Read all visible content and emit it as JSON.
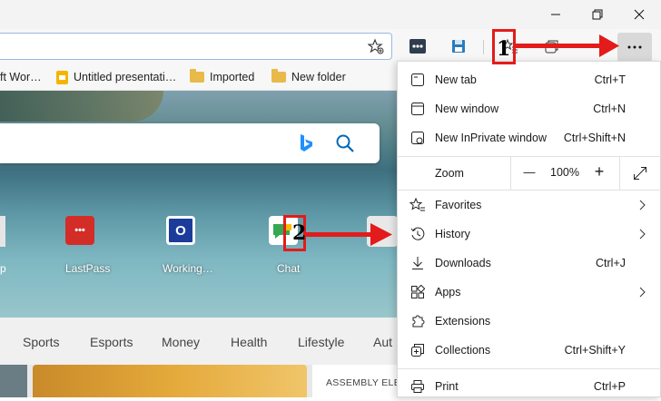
{
  "favorites_bar": {
    "items": [
      {
        "label": "ft Wor…"
      },
      {
        "label": "Untitled presentati…"
      },
      {
        "label": "Imported"
      },
      {
        "label": "New folder"
      }
    ]
  },
  "quick_links": [
    {
      "label": "LastPass",
      "glyph": "•••",
      "color": "#d32d27"
    },
    {
      "label": "Working…",
      "glyph": "O",
      "color": "#1b3c9a"
    },
    {
      "label": "Chat",
      "glyph": "",
      "color": "#34a853"
    }
  ],
  "categories": [
    "Sports",
    "Esports",
    "Money",
    "Health",
    "Lifestyle",
    "Aut"
  ],
  "news_snippet": "ASSEMBLY ELE",
  "menu": {
    "new_tab": {
      "label": "New tab",
      "shortcut": "Ctrl+T"
    },
    "new_window": {
      "label": "New window",
      "shortcut": "Ctrl+N"
    },
    "inprivate": {
      "label": "New InPrivate window",
      "shortcut": "Ctrl+Shift+N"
    },
    "zoom": {
      "label": "Zoom",
      "minus": "—",
      "value": "100%",
      "plus": "+"
    },
    "favorites": {
      "label": "Favorites"
    },
    "history": {
      "label": "History"
    },
    "downloads": {
      "label": "Downloads",
      "shortcut": "Ctrl+J"
    },
    "apps": {
      "label": "Apps"
    },
    "extensions": {
      "label": "Extensions"
    },
    "collections": {
      "label": "Collections",
      "shortcut": "Ctrl+Shift+Y"
    },
    "print": {
      "label": "Print",
      "shortcut": "Ctrl+P"
    }
  },
  "annotations": {
    "step1": "1",
    "step2": "2"
  },
  "colors": {
    "annotation_red": "#e31b1b",
    "accent_blue": "#0067b8",
    "bing_blue": "#1e90ff"
  }
}
